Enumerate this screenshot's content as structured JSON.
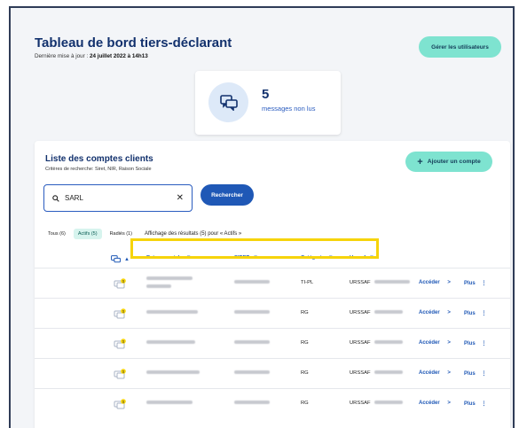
{
  "header": {
    "title": "Tableau de bord tiers-déclarant",
    "updated_prefix": "Dernière mise à jour :",
    "updated_value": "24 juillet 2022 à 14h13",
    "manage_users_label": "Gérer les utilisateurs"
  },
  "messages": {
    "count": "5",
    "label": "messages non lus",
    "icon": "chat-bubbles-icon"
  },
  "list": {
    "title": "Liste des comptes clients",
    "criteria": "Critères de recherche: Siret, NIR, Raison Sociale",
    "add_label": "Ajouter un compte",
    "search_value": "SARL",
    "search_button": "Rechercher",
    "filters": [
      {
        "label": "Tous (6)",
        "active": false
      },
      {
        "label": "Actifs (5)",
        "active": true
      },
      {
        "label": "Radiés (1)",
        "active": false
      }
    ],
    "filter_description": "Affichage des résultats (5) pour « Actifs »",
    "columns": {
      "raison": "Raison sociale",
      "siret": "SIRET",
      "categorie": "Catégorie",
      "urssaf": "Urssaf"
    },
    "rows": [
      {
        "categorie": "TI-PL",
        "urssaf": "URSSAF",
        "acceder": "Accéder",
        "plus": "Plus"
      },
      {
        "categorie": "RG",
        "urssaf": "URSSAF",
        "acceder": "Accéder",
        "plus": "Plus"
      },
      {
        "categorie": "RG",
        "urssaf": "URSSAF",
        "acceder": "Accéder",
        "plus": "Plus"
      },
      {
        "categorie": "RG",
        "urssaf": "URSSAF",
        "acceder": "Accéder",
        "plus": "Plus"
      },
      {
        "categorie": "RG",
        "urssaf": "URSSAF",
        "acceder": "Accéder",
        "plus": "Plus"
      }
    ],
    "notification_badge": "1"
  },
  "colors": {
    "brand_dark": "#12316d",
    "accent_teal": "#7ee3d0",
    "primary_blue": "#1f58b6",
    "highlight_yellow": "#f6d40b"
  }
}
